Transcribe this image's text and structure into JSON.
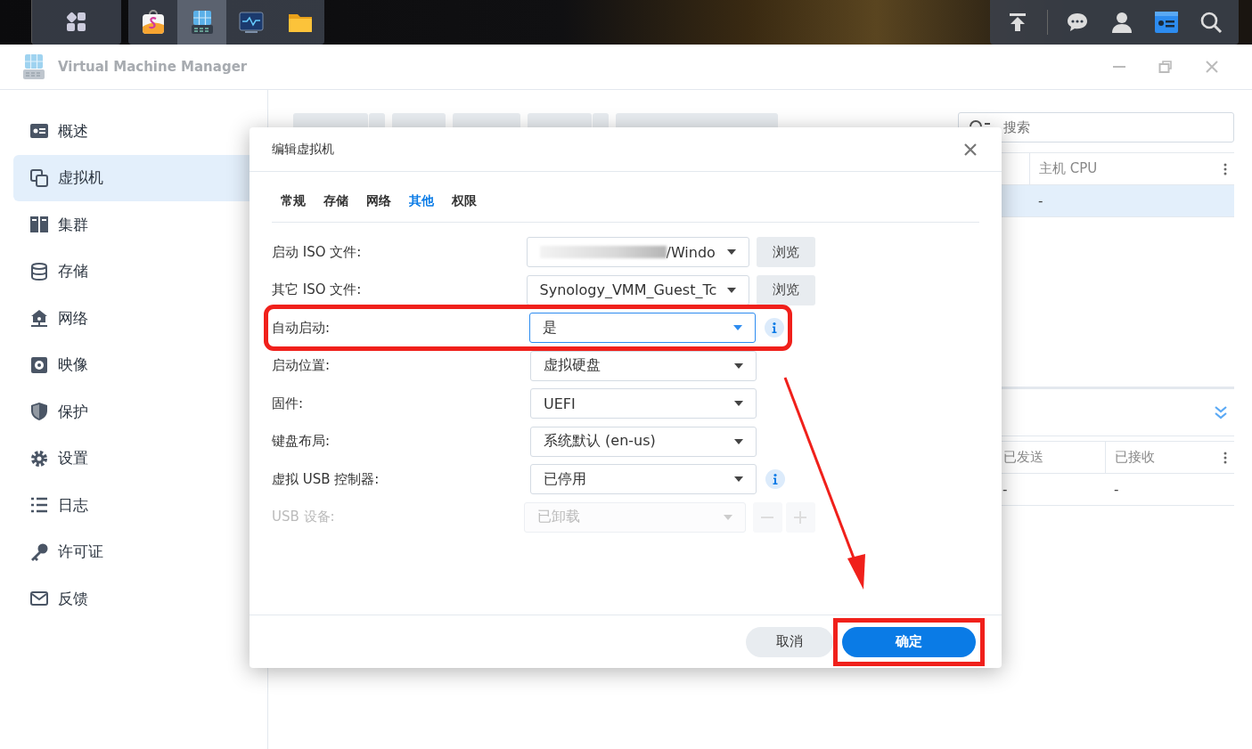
{
  "taskbar": {
    "apps": [
      {
        "kind": "package",
        "selected": false
      },
      {
        "kind": "vmm",
        "selected": true
      },
      {
        "kind": "monitor",
        "selected": false
      },
      {
        "kind": "folder",
        "selected": false
      }
    ]
  },
  "window": {
    "title": "Virtual Machine Manager"
  },
  "sidebar": {
    "items": [
      {
        "label": "概述",
        "kind": "overview",
        "selected": false
      },
      {
        "label": "虚拟机",
        "kind": "vm",
        "selected": true
      },
      {
        "label": "集群",
        "kind": "cluster",
        "selected": false
      },
      {
        "label": "存储",
        "kind": "storage",
        "selected": false
      },
      {
        "label": "网络",
        "kind": "network",
        "selected": false
      },
      {
        "label": "映像",
        "kind": "image",
        "selected": false
      },
      {
        "label": "保护",
        "kind": "shield",
        "selected": false
      },
      {
        "label": "设置",
        "kind": "gear",
        "selected": false
      },
      {
        "label": "日志",
        "kind": "log",
        "selected": false
      },
      {
        "label": "许可证",
        "kind": "key",
        "selected": false
      },
      {
        "label": "反馈",
        "kind": "mail",
        "selected": false
      }
    ]
  },
  "search": {
    "placeholder": "搜索"
  },
  "vm_table": {
    "columns": [
      "主机 CPU"
    ],
    "rows": [
      {
        "cells": [
          "-"
        ],
        "selected": true
      }
    ]
  },
  "network_table": {
    "columns": [
      "已发送",
      "已接收"
    ],
    "rows": [
      {
        "cells": [
          "-",
          "-"
        ]
      }
    ]
  },
  "dialog": {
    "title": "编辑虚拟机",
    "tabs": [
      {
        "label": "常规",
        "selected": false
      },
      {
        "label": "存储",
        "selected": false
      },
      {
        "label": "网络",
        "selected": false
      },
      {
        "label": "其他",
        "selected": true
      },
      {
        "label": "权限",
        "selected": false
      }
    ],
    "fields": [
      {
        "label": "启动 ISO 文件:",
        "value": "/Windo",
        "redacted": true,
        "browse": "浏览",
        "info": false,
        "disabled": false,
        "focused": false,
        "highlighted": false,
        "stepper": false
      },
      {
        "label": "其它 ISO 文件:",
        "value": "Synology_VMM_Guest_Tc",
        "redacted": false,
        "browse": "浏览",
        "info": false,
        "disabled": false,
        "focused": false,
        "highlighted": false,
        "stepper": false
      },
      {
        "label": "自动启动:",
        "value": "是",
        "redacted": false,
        "info": true,
        "disabled": false,
        "focused": true,
        "highlighted": true,
        "stepper": false
      },
      {
        "label": "启动位置:",
        "value": "虚拟硬盘",
        "redacted": false,
        "info": false,
        "disabled": false,
        "focused": false,
        "highlighted": false,
        "stepper": false
      },
      {
        "label": "固件:",
        "value": "UEFI",
        "redacted": false,
        "info": false,
        "disabled": false,
        "focused": false,
        "highlighted": false,
        "stepper": false
      },
      {
        "label": "键盘布局:",
        "value": "系统默认 (en-us)",
        "redacted": false,
        "info": false,
        "disabled": false,
        "focused": false,
        "highlighted": false,
        "stepper": false
      },
      {
        "label": "虚拟 USB 控制器:",
        "value": "已停用",
        "redacted": false,
        "info": true,
        "disabled": false,
        "focused": false,
        "highlighted": false,
        "stepper": false
      },
      {
        "label": "USB 设备:",
        "value": "已卸载",
        "redacted": false,
        "info": false,
        "disabled": true,
        "focused": false,
        "highlighted": false,
        "stepper": true
      }
    ],
    "buttons": [
      {
        "label": "取消",
        "kind": "secondary",
        "highlighted": false
      },
      {
        "label": "确定",
        "kind": "primary",
        "highlighted": true
      }
    ]
  }
}
